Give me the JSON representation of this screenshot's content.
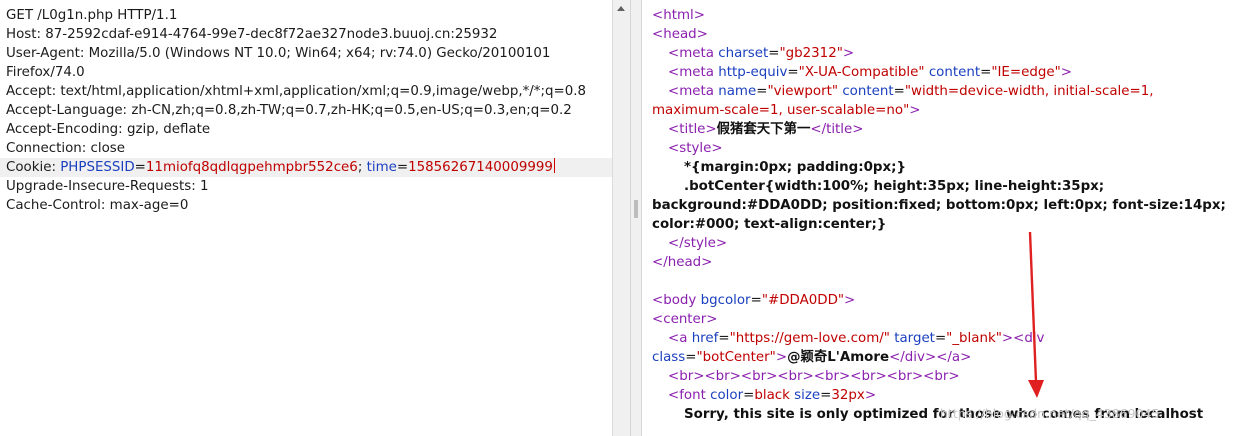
{
  "request": {
    "lines": [
      "GET /L0g1n.php HTTP/1.1",
      "Host: 87-2592cdaf-e914-4764-99e7-dec8f72ae327node3.buuoj.cn:25932",
      "User-Agent: Mozilla/5.0 (Windows NT 10.0; Win64; x64; rv:74.0) Gecko/20100101",
      "Firefox/74.0",
      "Accept: text/html,application/xhtml+xml,application/xml;q=0.9,image/webp,*/*;q=0.8",
      "Accept-Language: zh-CN,zh;q=0.8,zh-TW;q=0.7,zh-HK;q=0.5,en-US;q=0.3,en;q=0.2",
      "Accept-Encoding: gzip, deflate",
      "Connection: close"
    ],
    "cookie": {
      "label": "Cookie: ",
      "k1": "PHPSESSID",
      "eq": "=",
      "v1": "11miofq8qdlqgpehmpbr552ce6",
      "sep": "; ",
      "k2": "time",
      "v2": "15856267140009999"
    },
    "tail_lines": [
      "Upgrade-Insecure-Requests: 1",
      "Cache-Control: max-age=0"
    ]
  },
  "response": {
    "html_open": "<html>",
    "head_open": "<head>",
    "meta1": {
      "open": "<meta ",
      "a": "charset",
      "eq": "=",
      "v": "\"gb2312\"",
      "close": ">"
    },
    "meta2": {
      "open": "<meta ",
      "a1": "http-equiv",
      "v1": "\"X-UA-Compatible\"",
      "a2": "content",
      "v2": "\"IE=edge\"",
      "close": ">"
    },
    "meta3": {
      "open": "<meta ",
      "a1": "name",
      "v1": "\"viewport\"",
      "a2": "content",
      "v2": "\"width=device-width, initial-scale=1,",
      "v2b": "maximum-scale=1, user-scalable=no\"",
      "close": ">"
    },
    "title": {
      "open": "<title>",
      "text": "假猪套天下第一",
      "close": "</title>"
    },
    "style_open": "<style>",
    "css1": "*{margin:0px; padding:0px;}",
    "css2": ".botCenter{width:100%; height:35px; line-height:35px;",
    "css3": "background:#DDA0DD; position:fixed; bottom:0px; left:0px; font-size:14px;",
    "css4": "color:#000; text-align:center;}",
    "style_close": "</style>",
    "head_close": "</head>",
    "body": {
      "open": "<body ",
      "a": "bgcolor",
      "v": "\"#DDA0DD\"",
      "close": ">"
    },
    "center_open": "<center>",
    "anchor": {
      "open": "<a ",
      "a1": "href",
      "v1": "\"https://gem-love.com/\"",
      "a2": "target",
      "v2": "\"_blank\"",
      "close": ">",
      "div_open": "<div"
    },
    "anchor2": {
      "a": "class",
      "v": "\"botCenter\"",
      "close": ">",
      "text": "@颖奇L'Amore",
      "div_close": "</div>",
      "a_close": "</a>"
    },
    "brs": "<br><br><br><br><br><br><br><br>",
    "font": {
      "open": "<font ",
      "a1": "color",
      "v1": "black",
      "a2": "size",
      "v2": "32px",
      "close": ">"
    },
    "message": "Sorry, this site is only optimized for those who comes from localhost"
  },
  "watermark": "https://blog.csdn.net/qq_43869045",
  "colors": {
    "annotation_arrow": "#e02020"
  }
}
